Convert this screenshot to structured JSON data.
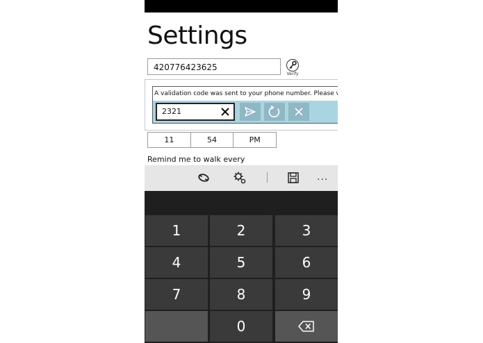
{
  "page": {
    "title": "Settings"
  },
  "phone_field": {
    "value": "420776423625"
  },
  "verify": {
    "label": "Verify",
    "icon": "key-icon"
  },
  "validation": {
    "message": "A validation code was sent to your phone number. Please write it",
    "code_value": "2321",
    "accent_color": "#a9d4e1"
  },
  "time": {
    "hour": "11",
    "minute": "54",
    "period": "PM"
  },
  "remind": {
    "label": "Remind me to walk every"
  },
  "appbar": {
    "icons": [
      "sync-icon",
      "settings-icon",
      "save-icon"
    ],
    "more_label": "..."
  },
  "keypad": {
    "keys": [
      "1",
      "2",
      "3",
      "4",
      "5",
      "6",
      "7",
      "8",
      "9",
      "",
      "0",
      "backspace"
    ]
  }
}
